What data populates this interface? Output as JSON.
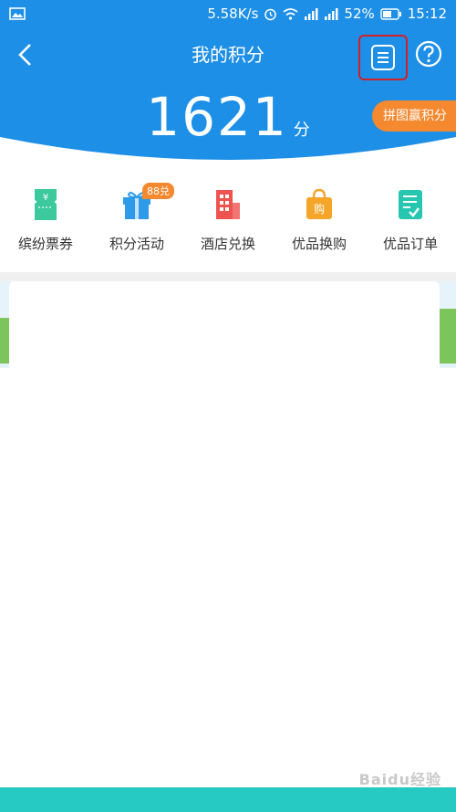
{
  "status_bar": {
    "network_speed": "5.58K/s",
    "battery": "52%",
    "time": "15:12"
  },
  "header": {
    "title": "我的积分",
    "back_icon": "chevron-left-icon",
    "menu_icon": "list-icon",
    "help_icon": "question-circle-icon"
  },
  "points": {
    "value": "1621",
    "unit": "分",
    "puzzle_button": "拼图赢积分"
  },
  "quick_menu": [
    {
      "label": "缤纷票券",
      "icon": "ticket-icon",
      "color": "#3cc99c"
    },
    {
      "label": "积分活动",
      "icon": "gift-icon",
      "color": "#2f9be8",
      "badge": "88兑"
    },
    {
      "label": "酒店兑换",
      "icon": "hotel-icon",
      "color": "#ef5350"
    },
    {
      "label": "优品换购",
      "icon": "shopping-bag-icon",
      "color": "#f4a52a",
      "glyph": "购"
    },
    {
      "label": "优品订单",
      "icon": "order-list-icon",
      "color": "#26c6b0"
    }
  ],
  "colors": {
    "primary": "#1e8fe6",
    "accent": "#f4892f",
    "bottom_bar": "#27c9c3"
  },
  "watermark": "Baidu经验"
}
